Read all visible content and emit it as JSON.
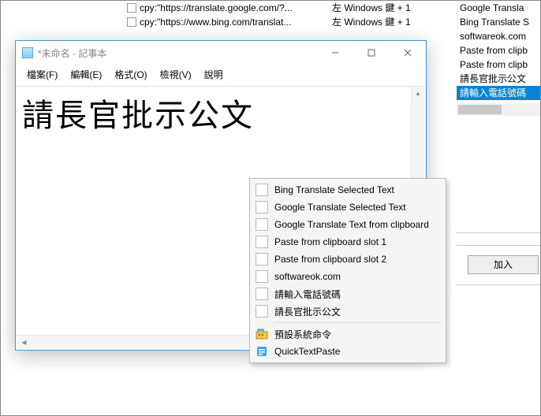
{
  "bg": {
    "rows": [
      {
        "cmd": "cpy:\"https://translate.google.com/?...",
        "key": "左 Windows 鍵 + 1",
        "label": "Google Transla"
      },
      {
        "cmd": "cpy:\"https://www.bing.com/translat...",
        "key": "左 Windows 鍵 + 1",
        "label": "Bing Translate S"
      }
    ],
    "list": [
      "Google Transla",
      "Bing Translate S",
      "softwareok.com",
      "Paste from clipb",
      "Paste from clipb",
      "請長官批示公文",
      "請輸入電話號碼"
    ],
    "selected_index": 6,
    "add_button": "加入"
  },
  "notepad": {
    "title": "*未命名 - 記事本",
    "menus": [
      "檔案(F)",
      "編輯(E)",
      "格式(O)",
      "檢視(V)",
      "說明"
    ],
    "content": "請長官批示公文"
  },
  "context_menu": {
    "items": [
      {
        "icon": "page",
        "label": "Bing Translate Selected Text"
      },
      {
        "icon": "page",
        "label": "Google Translate Selected Text"
      },
      {
        "icon": "page",
        "label": "Google Translate Text from clipboard"
      },
      {
        "icon": "page",
        "label": "Paste from clipboard slot 1"
      },
      {
        "icon": "page",
        "label": "Paste from clipboard slot 2"
      },
      {
        "icon": "page",
        "label": "softwareok.com"
      },
      {
        "icon": "page",
        "label": "請輸入電話號碼"
      },
      {
        "icon": "page",
        "label": "請長官批示公文"
      }
    ],
    "footer": [
      {
        "icon": "preset",
        "label": "預設系統命令"
      },
      {
        "icon": "qtp",
        "label": "QuickTextPaste"
      }
    ]
  }
}
